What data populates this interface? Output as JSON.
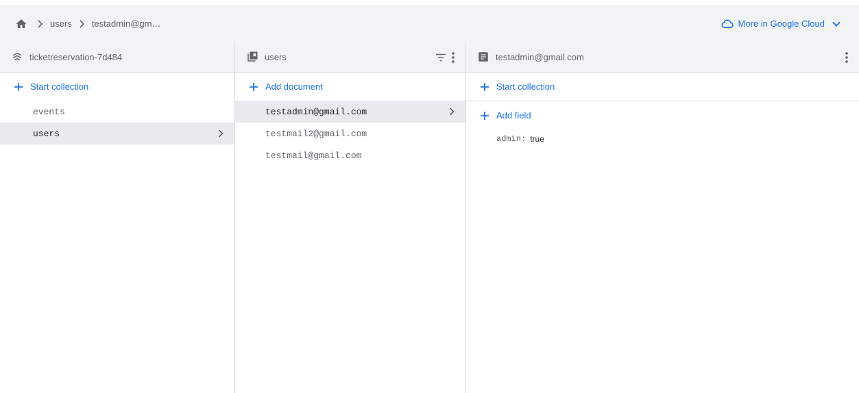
{
  "breadcrumb": {
    "items": [
      "users",
      "testadmin@gm…"
    ]
  },
  "header": {
    "more_cloud": "More in Google Cloud"
  },
  "project_panel": {
    "title": "ticketreservation-7d484",
    "start_collection": "Start collection",
    "collections": [
      "events",
      "users"
    ],
    "selected_index": 1
  },
  "collection_panel": {
    "title": "users",
    "add_document": "Add document",
    "documents": [
      "testadmin@gmail.com",
      "testmail2@gmail.com",
      "testmail@gmail.com"
    ],
    "selected_index": 0
  },
  "document_panel": {
    "title": "testadmin@gmail.com",
    "start_collection": "Start collection",
    "add_field": "Add field",
    "fields": [
      {
        "key": "admin:",
        "value": "true"
      }
    ]
  },
  "colors": {
    "accent": "#1a73e8",
    "header_bg": "#f1f3f4",
    "selected_bg": "#e8eaed"
  },
  "icons": {
    "home": "home-icon",
    "breadcrumb_sep": "chevron-right-icon",
    "cloud": "cloud-icon",
    "dropdown": "chevron-down-icon",
    "project": "firestore-icon",
    "collection": "collection-icon",
    "document": "document-icon",
    "filter": "filter-icon",
    "menu": "more-vert-icon",
    "add": "plus-icon"
  }
}
